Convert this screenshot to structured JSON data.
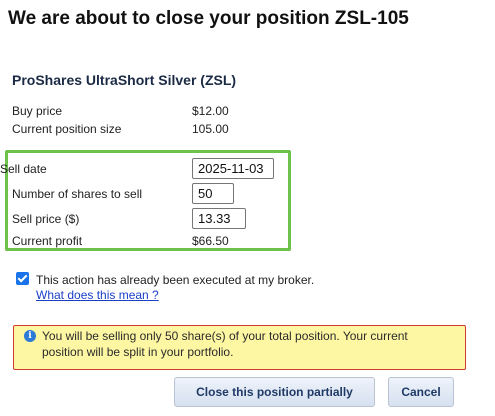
{
  "header": {
    "title": "We are about to close your position ZSL-105"
  },
  "position": {
    "name": "ProShares UltraShort Silver (ZSL)",
    "buy_price_label": "Buy price",
    "buy_price": "$12.00",
    "current_size_label": "Current position size",
    "current_size": "105.00"
  },
  "form": {
    "sell_date_label": "Sell date",
    "sell_date": "2025-11-03",
    "shares_label": "Number of shares to sell",
    "shares": "50",
    "sell_price_label": "Sell price ($)",
    "sell_price": "13.33",
    "profit_label": "Current profit",
    "profit": "$66.50"
  },
  "executed": {
    "checked": true,
    "label": "This action has already been executed at my broker.",
    "help_link": "What does this mean ?"
  },
  "alert": {
    "text": "You will be selling only 50 share(s) of your total position. Your current position will be split in your portfolio.",
    "icon": "info-icon",
    "icon_glyph": "i"
  },
  "actions": {
    "close_partial_label": "Close this position partially",
    "cancel_label": "Cancel"
  },
  "colors": {
    "highlight_border": "#6cc24a",
    "alert_background": "#fdf6a3",
    "alert_border": "#d33b2c",
    "link": "#1a3fc7",
    "checkbox": "#1a73e8"
  }
}
